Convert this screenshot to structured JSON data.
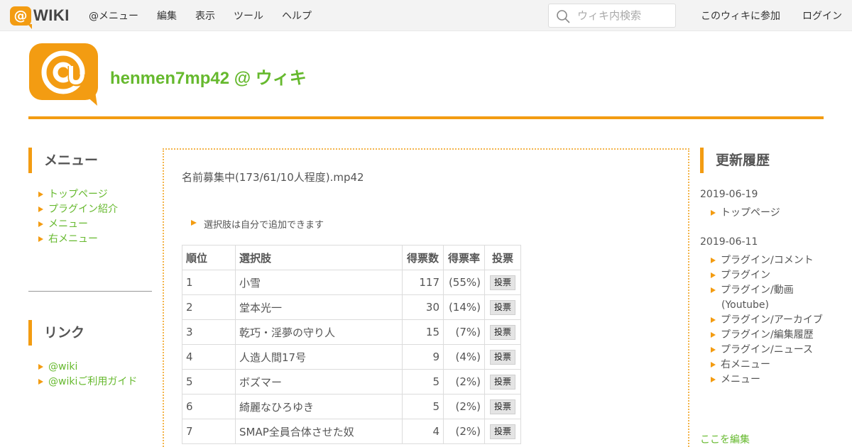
{
  "topbar": {
    "brand_at": "@",
    "brand_word": "WIKI",
    "nav": [
      "@メニュー",
      "編集",
      "表示",
      "ツール",
      "ヘルプ"
    ],
    "search_placeholder": "ウィキ内検索",
    "join_label": "このウィキに参加",
    "login_label": "ログイン"
  },
  "header": {
    "site_title": "henmen7mp42 @ ウィキ"
  },
  "left_sidebar": {
    "menu_title": "メニュー",
    "menu_items": [
      "トップページ",
      "プラグイン紹介",
      "メニュー",
      "右メニュー"
    ],
    "links_title": "リンク",
    "link_items": [
      "@wiki",
      "@wikiご利用ガイド"
    ]
  },
  "main": {
    "heading": "名前募集中(173/61/10人程度).mp42",
    "note": "選択肢は自分で追加できます",
    "table": {
      "headers": [
        "順位",
        "選択肢",
        "得票数",
        "得票率",
        "投票"
      ],
      "vote_label": "投票",
      "rows": [
        {
          "rank": "1",
          "choice": "小雪",
          "votes": "117",
          "rate": "(55%)"
        },
        {
          "rank": "2",
          "choice": "堂本光一",
          "votes": "30",
          "rate": "(14%)"
        },
        {
          "rank": "3",
          "choice": "乾巧・淫夢の守り人",
          "votes": "15",
          "rate": "(7%)"
        },
        {
          "rank": "4",
          "choice": "人造人間17号",
          "votes": "9",
          "rate": "(4%)"
        },
        {
          "rank": "5",
          "choice": "ボズマー",
          "votes": "5",
          "rate": "(2%)"
        },
        {
          "rank": "6",
          "choice": "綺麗なひろゆき",
          "votes": "5",
          "rate": "(2%)"
        },
        {
          "rank": "7",
          "choice": "SMAP全員合体させた奴",
          "votes": "4",
          "rate": "(2%)"
        }
      ]
    }
  },
  "right_sidebar": {
    "title": "更新履歴",
    "groups": [
      {
        "date": "2019-06-19",
        "items": [
          "トップページ"
        ]
      },
      {
        "date": "2019-06-11",
        "items": [
          "プラグイン/コメント",
          "プラグイン",
          "プラグイン/動画",
          "(Youtube)",
          "プラグイン/アーカイブ",
          "プラグイン/編集履歴",
          "プラグイン/ニュース",
          "右メニュー",
          "メニュー"
        ]
      }
    ],
    "edit_link": "ここを編集"
  },
  "colors": {
    "accent": "#f39c12",
    "title_green": "#66b92e",
    "text": "#555555"
  }
}
